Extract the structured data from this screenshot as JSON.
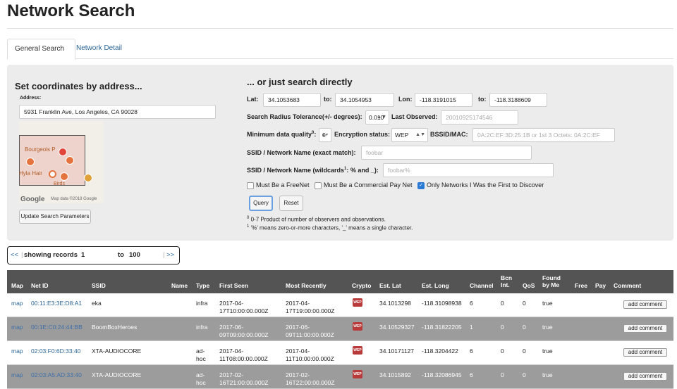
{
  "page": {
    "title": "Network Search"
  },
  "tabs": [
    {
      "label": "General Search",
      "active": true
    },
    {
      "label": "Network Detail",
      "active": false
    }
  ],
  "address_panel": {
    "heading": "Set coordinates by address...",
    "address_label": "Address:",
    "address_value": "5931 Franklin Ave, Los Angeles, CA 90028",
    "map_labels": [
      "Bourgeois P",
      "Hyla Hair",
      "Birds"
    ],
    "map_logo": "Google",
    "map_attribution": "Map data ©2018 Google",
    "update_button": "Update Search Parameters"
  },
  "search_panel": {
    "heading": "... or just search directly",
    "lat_label": "Lat:",
    "lat_from": "34.1053683",
    "to_label": "to:",
    "lat_to": "34.1054953",
    "lon_label": "Lon:",
    "lon_from": "-118.3191015",
    "lon_to": "-118.3188609",
    "radius_label": "Search Radius Tolerance(+/- degrees):",
    "radius_value": "0.010",
    "last_observed_label": "Last Observed:",
    "last_observed_placeholder": "20010925174546",
    "quality_label": "Minimum data quality",
    "quality_sup": "0",
    "quality_value": "0",
    "encryption_label": "Encryption status:",
    "encryption_value": "WEP",
    "bssid_label": "BSSID/MAC:",
    "bssid_placeholder": "0A:2C:EF:3D:25:1B or 1st 3 Octets: 0A:2C:EF",
    "ssid_exact_label": "SSID / Network Name (exact match):",
    "ssid_exact_placeholder": "foobar",
    "ssid_wild_label_a": "SSID / Network Name (wildcards",
    "ssid_wild_sup": "1",
    "ssid_wild_label_b": ": % and _):",
    "ssid_wild_placeholder": "foobar%",
    "checkboxes": [
      {
        "label": "Must Be a FreeNet",
        "checked": false
      },
      {
        "label": "Must Be a Commercial Pay Net",
        "checked": false
      },
      {
        "label": "Only Networks I Was the First to Discover",
        "checked": true
      }
    ],
    "query_button": "Query",
    "reset_button": "Reset",
    "footnote0_sup": "0",
    "footnote0": "0-7 Product of number of observers and observations.",
    "footnote1_sup": "1",
    "footnote1": "'%' means zero-or-more characters, '_' means a single character."
  },
  "pager": {
    "prev": "<<",
    "showing_label": "showing records",
    "from": "1",
    "to_label": "to",
    "to": "100",
    "next": ">>"
  },
  "table": {
    "headers": {
      "map": "Map",
      "netid": "Net ID",
      "ssid": "SSID",
      "name": "Name",
      "type": "Type",
      "first_seen": "First Seen",
      "most_recently": "Most Recently",
      "crypto": "Crypto",
      "est_lat": "Est. Lat",
      "est_long": "Est. Long",
      "channel": "Channel",
      "bcn_int_a": "Bcn",
      "bcn_int_b": "Int.",
      "qos": "QoS",
      "found_a": "Found",
      "found_b": "by Me",
      "free": "Free",
      "pay": "Pay",
      "comment": "Comment"
    },
    "crypto_badge": "WEP",
    "rows": [
      {
        "map": "map",
        "netid": "00:11:E3:3E:D8:A1",
        "ssid": "eka",
        "type_a": "infra",
        "type_b": "",
        "first_a": "2017-04-",
        "first_b": "17T10:00:00.000Z",
        "recent_a": "2017-04-",
        "recent_b": "17T19:00:00.000Z",
        "lat": "34.1013298",
        "lon": "-118.31098938",
        "channel": "6",
        "bcn": "0",
        "qos": "0",
        "found": "true",
        "comment": "add comment"
      },
      {
        "map": "map",
        "netid": "00:1E:C0:24:44:BB",
        "ssid": "BoomBoxHeroes",
        "type_a": "infra",
        "type_b": "",
        "first_a": "2017-06-",
        "first_b": "09T09:00:00.000Z",
        "recent_a": "2017-06-",
        "recent_b": "09T11:00:00.000Z",
        "lat": "34.10529327",
        "lon": "-118.31822205",
        "channel": "1",
        "bcn": "0",
        "qos": "0",
        "found": "true",
        "comment": "add comment"
      },
      {
        "map": "map",
        "netid": "02:03:F0:6D:33:40",
        "ssid": "XTA-AUDIOCORE",
        "type_a": "ad-",
        "type_b": "hoc",
        "first_a": "2017-04-",
        "first_b": "11T08:00:00.000Z",
        "recent_a": "2017-04-",
        "recent_b": "11T10:00:00.000Z",
        "lat": "34.10171127",
        "lon": "-118.3204422",
        "channel": "6",
        "bcn": "0",
        "qos": "0",
        "found": "true",
        "comment": "add comment"
      },
      {
        "map": "map",
        "netid": "02:03:A5:AD:33:40",
        "ssid": "XTA-AUDIOCORE",
        "type_a": "ad-",
        "type_b": "hoc",
        "first_a": "2017-02-",
        "first_b": "16T21:00:00.000Z",
        "recent_a": "2017-02-",
        "recent_b": "16T22:00:00.000Z",
        "lat": "34.1015892",
        "lon": "-118.32086945",
        "channel": "6",
        "bcn": "0",
        "qos": "0",
        "found": "true",
        "comment": "add comment"
      }
    ]
  }
}
